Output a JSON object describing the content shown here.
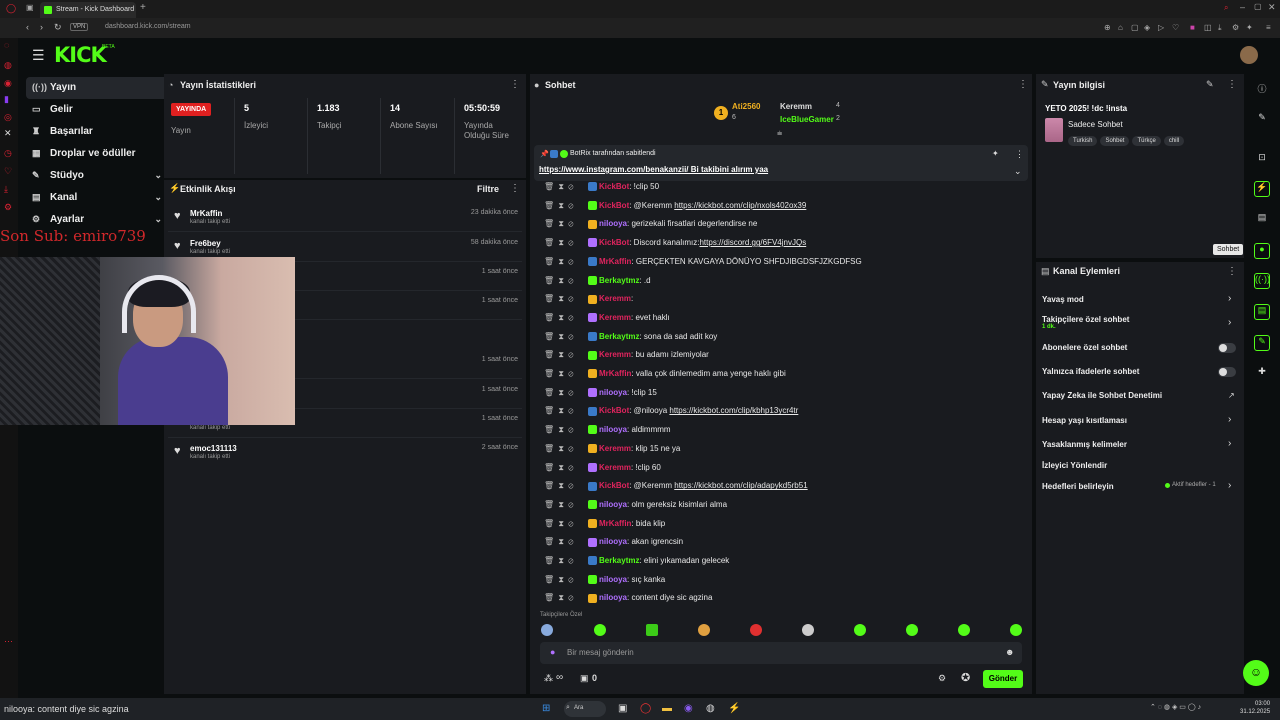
{
  "browser": {
    "tab_title": "Stream - Kick Dashboard",
    "url": "dashboard.kick.com/stream",
    "vpn": "VPN",
    "new_tab": "+"
  },
  "brand": {
    "logo": "KICK",
    "beta": "BETA"
  },
  "nav": {
    "items": [
      {
        "label": "Yayın",
        "icon": "stream-icon"
      },
      {
        "label": "Gelir",
        "icon": "wallet-icon"
      },
      {
        "label": "Başarılar",
        "icon": "trophy-icon"
      },
      {
        "label": "Droplar ve ödüller",
        "icon": "gift-icon"
      },
      {
        "label": "Stüdyo",
        "icon": "studio-icon"
      },
      {
        "label": "Kanal",
        "icon": "channel-icon"
      },
      {
        "label": "Ayarlar",
        "icon": "settings-icon"
      }
    ]
  },
  "stats": {
    "title": "Yayın İstatistikleri",
    "live_badge": "YAYINDA",
    "live_label": "Yayın",
    "viewers": "5",
    "viewers_label": "İzleyici",
    "followers": "1.183",
    "followers_label": "Takipçi",
    "subs": "14",
    "subs_label": "Abone Sayısı",
    "uptime": "05:50:59",
    "uptime_label": "Yayında Olduğu Süre"
  },
  "activity": {
    "title": "Etkinlik Akışı",
    "filter": "Filtre",
    "items": [
      {
        "name": "MrKaffin",
        "sub": "kanalı takip etti",
        "time": "23 dakika önce"
      },
      {
        "name": "Fre6bey",
        "sub": "kanalı takip etti",
        "time": "58 dakika önce"
      },
      {
        "name": "",
        "sub": "",
        "time": "1 saat önce"
      },
      {
        "name": "",
        "sub": "",
        "time": "1 saat önce"
      },
      {
        "name": "",
        "sub": "",
        "time": "1 saat önce"
      },
      {
        "name": "",
        "sub": "",
        "time": "1 saat önce"
      },
      {
        "name": "",
        "sub": "kanalı takip etti",
        "time": "1 saat önce"
      },
      {
        "name": "emoc131113",
        "sub": "kanalı takip etti",
        "time": "2 saat önce"
      }
    ]
  },
  "overlay": {
    "sub_text": "Son Sub: emiro739"
  },
  "chat": {
    "title": "Sohbet",
    "leaderboard": [
      {
        "name": "Ati2560",
        "count": "6"
      },
      {
        "name": "Keremm",
        "count": "4"
      },
      {
        "name": "IceBlueGamer",
        "count": "2"
      }
    ],
    "pinned_by": "BotRix tarafından sabitlendi",
    "pinned_text": "https://www.instagram.com/benakanzii/ Bi takibini alırım yaa",
    "messages": [
      {
        "user": "KickBot",
        "color": "#e0245e",
        "text": ": !clip 50",
        "link": ""
      },
      {
        "user": "KickBot",
        "color": "#e0245e",
        "text": ": @Keremm ",
        "link": "https://kickbot.com/clip/nxols402ox39"
      },
      {
        "user": "nilooya",
        "color": "#b070ff",
        "text": ": gerizekali firsatlari degerlendirse ne",
        "link": ""
      },
      {
        "user": "KickBot",
        "color": "#e0245e",
        "text": ": Discord kanalımız:",
        "link": "https://discord.gg/6FV4jnvJQs"
      },
      {
        "user": "MrKaffin",
        "color": "#e0245e",
        "text": ": GERÇEKTEN KAVGAYA DÖNÜYO SHFDJIBGDSFJZKGDFSG",
        "link": ""
      },
      {
        "user": "Berkaytmz",
        "color": "#53fc18",
        "text": ": .d",
        "link": ""
      },
      {
        "user": "Keremm",
        "color": "#e0245e",
        "text": ": ",
        "link": ""
      },
      {
        "user": "Keremm",
        "color": "#e0245e",
        "text": ": evet haklı",
        "link": ""
      },
      {
        "user": "Berkaytmz",
        "color": "#53fc18",
        "text": ": sona da sad adit koy",
        "link": ""
      },
      {
        "user": "Keremm",
        "color": "#e0245e",
        "text": ": bu adamı izlemiyolar",
        "link": ""
      },
      {
        "user": "MrKaffin",
        "color": "#e0245e",
        "text": ": valla çok dinlemedim ama yenge haklı gibi",
        "link": ""
      },
      {
        "user": "nilooya",
        "color": "#b070ff",
        "text": ": !clip 15",
        "link": ""
      },
      {
        "user": "KickBot",
        "color": "#e0245e",
        "text": ": @nilooya ",
        "link": "https://kickbot.com/clip/kbhp13ycr4tr"
      },
      {
        "user": "nilooya",
        "color": "#b070ff",
        "text": ": aldimmmm",
        "link": ""
      },
      {
        "user": "Keremm",
        "color": "#e0245e",
        "text": ": klip 15 ne ya",
        "link": ""
      },
      {
        "user": "Keremm",
        "color": "#e0245e",
        "text": ": !clip 60",
        "link": ""
      },
      {
        "user": "KickBot",
        "color": "#e0245e",
        "text": ": @Keremm ",
        "link": "https://kickbot.com/clip/adapykd5rb51"
      },
      {
        "user": "nilooya",
        "color": "#b070ff",
        "text": ": olm gereksiz kisimlari alma",
        "link": ""
      },
      {
        "user": "MrKaffin",
        "color": "#e0245e",
        "text": ": bida klip",
        "link": ""
      },
      {
        "user": "nilooya",
        "color": "#b070ff",
        "text": ": akan igrencsin",
        "link": ""
      },
      {
        "user": "Berkaytmz",
        "color": "#53fc18",
        "text": ": elini yıkamadan gelecek",
        "link": ""
      },
      {
        "user": "nilooya",
        "color": "#b070ff",
        "text": ": sıç kanka",
        "link": ""
      },
      {
        "user": "nilooya",
        "color": "#b070ff",
        "text": ": content diye sic agzina",
        "link": ""
      }
    ],
    "followers_only": "Takipçilere Özel",
    "input_placeholder": "Bir mesaj gönderin",
    "points": "∞",
    "count": "0",
    "send": "Gönder"
  },
  "stream_info": {
    "title": "Yayın bilgisi",
    "stream_title": "YETO 2025! !dc !insta",
    "category": "Sadece Sohbet",
    "tags": [
      "Turkish",
      "Sohbet",
      "Türkçe",
      "chill"
    ]
  },
  "channel_actions": {
    "title": "Kanal Eylemleri",
    "items": [
      {
        "label": "Yavaş mod",
        "sub": "",
        "control": "chevron"
      },
      {
        "label": "Takipçilere özel sohbet",
        "sub": "1 dk.",
        "control": "chevron"
      },
      {
        "label": "Abonelere özel sohbet",
        "sub": "",
        "control": "toggle"
      },
      {
        "label": "Yalnızca ifadelerle sohbet",
        "sub": "",
        "control": "toggle"
      },
      {
        "label": "Yapay Zeka ile Sohbet Denetimi",
        "sub": "",
        "control": "external"
      },
      {
        "label": "Hesap yaşı kısıtlaması",
        "sub": "",
        "control": "chevron"
      },
      {
        "label": "Yasaklanmış kelimeler",
        "sub": "",
        "control": "chevron"
      },
      {
        "label": "İzleyici Yönlendir",
        "sub": "",
        "control": "none"
      },
      {
        "label": "Hedefleri belirleyin",
        "sub": "",
        "control": "chevron"
      }
    ],
    "active_goals": "Aktif hedefler - 1"
  },
  "tooltip": "Sohbet",
  "taskbar": {
    "search": "Ara",
    "time": "03:00",
    "date": "31.12.2025",
    "ticker": "nilooya: content diye sic agzina"
  },
  "colors": {
    "accent": "#53fc18",
    "live": "#e02020",
    "panel": "#191b1f",
    "bg": "#0b0e0f"
  }
}
